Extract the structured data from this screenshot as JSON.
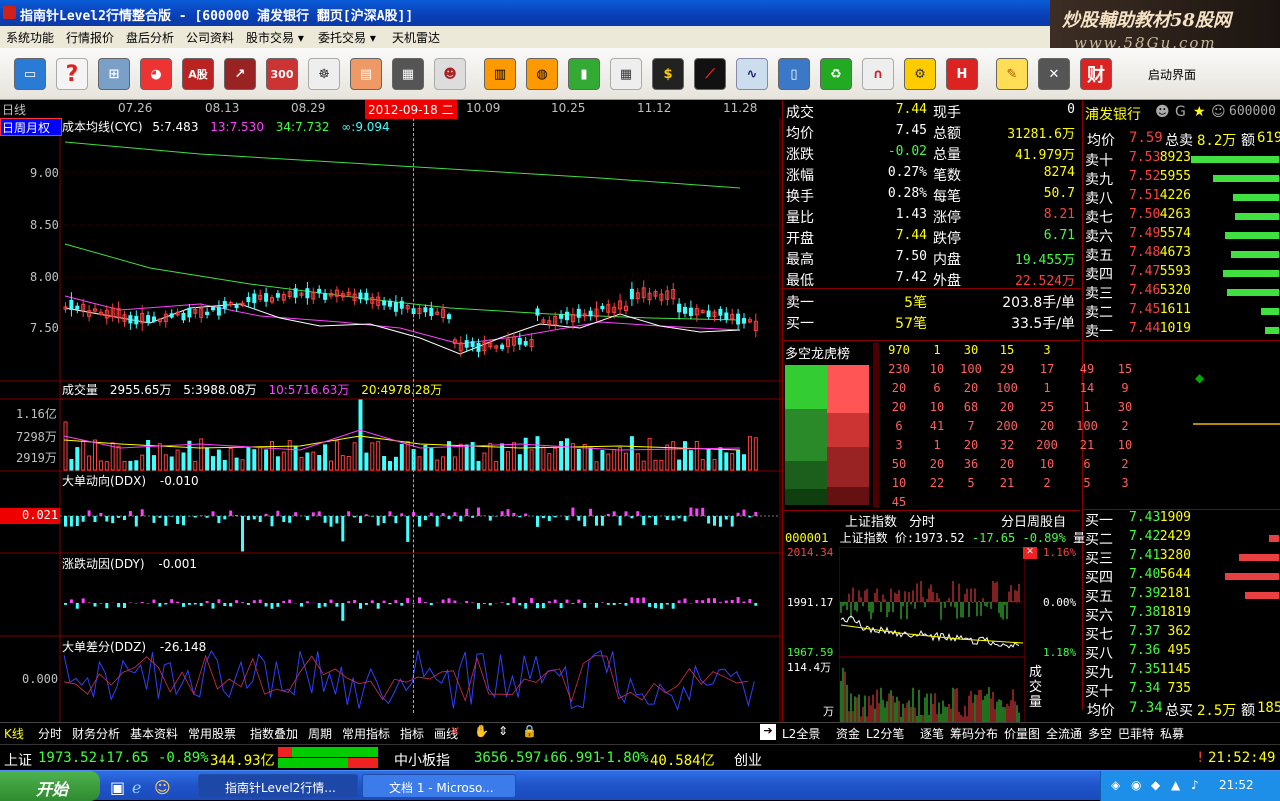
{
  "window": {
    "title": "指南针Level2行情整合版 - [600000 浦发银行 翻页[沪深A股]]"
  },
  "watermark": {
    "line1": "炒股輔助教材58股网",
    "line2": "www.58Gu.com"
  },
  "menu": [
    "系统功能",
    "行情报价",
    "盘后分析",
    "公司资料",
    "股市交易 ▾",
    "委托交易 ▾",
    "天机雷达"
  ],
  "toolbar": {
    "start_label": "启动界面",
    "icons": [
      "monitor-icon",
      "help-icon",
      "network-icon",
      "pie-icon",
      "a-share-icon",
      "chart-icon",
      "index300-icon",
      "helm-icon",
      "books-icon",
      "report-icon",
      "robot-icon",
      "calendar-icon",
      "ball-icon",
      "bar-icon",
      "grid-icon",
      "dollar-icon",
      "trend-icon",
      "line-icon",
      "cylinder-icon",
      "recycle-icon",
      "magnet-icon",
      "gear-icon",
      "h-icon",
      "pencil-icon",
      "swords-icon",
      "finance-icon"
    ]
  },
  "kline": {
    "period": "日线",
    "tabs": "日周月权",
    "indicator": "成本均线(CYC)",
    "ma5": "5:7.483",
    "ma13": "13:7.530",
    "ma34": "34:7.732",
    "mainf": "∞:9.094",
    "dates": [
      "07.26",
      "08.13",
      "08.29",
      "10.09",
      "10.25",
      "11.12",
      "11.28"
    ],
    "cursor_date": "2012-09-18 二",
    "yticks": [
      "9.00",
      "8.50",
      "8.00",
      "7.50"
    ]
  },
  "volume": {
    "label": "成交量",
    "value": "2955.65万",
    "ma5": "5:3988.08万",
    "ma10": "10:5716.63万",
    "ma20": "20:4978.28万",
    "ticks": [
      "1.16亿",
      "7298万",
      "2919万"
    ]
  },
  "ddx": {
    "label": "大单动向(DDX)",
    "value": "-0.010",
    "highlight": "0.021"
  },
  "ddy": {
    "label": "涨跌动因(DDY)",
    "value": "-0.001"
  },
  "ddz": {
    "label": "大单差分(DDZ)",
    "value": "-26.148",
    "tick": "0.000"
  },
  "quote": {
    "rows": [
      [
        "成交",
        "7.44",
        "现手",
        "0"
      ],
      [
        "均价",
        "7.45",
        "总额",
        "31281.6万"
      ],
      [
        "涨跌",
        "-0.02",
        "总量",
        "41.979万"
      ],
      [
        "涨幅",
        "0.27%",
        "笔数",
        "8274"
      ],
      [
        "换手",
        "0.28%",
        "每笔",
        "50.7"
      ],
      [
        "量比",
        "1.43",
        "涨停",
        "8.21"
      ],
      [
        "开盘",
        "7.44",
        "跌停",
        "6.71"
      ],
      [
        "最高",
        "7.50",
        "内盘",
        "19.455万"
      ],
      [
        "最低",
        "7.42",
        "外盘",
        "22.524万"
      ]
    ],
    "sell1": [
      "卖一",
      "5笔",
      "203.8手/单"
    ],
    "buy1": [
      "买一",
      "57笔",
      "33.5手/单"
    ]
  },
  "orderbook": {
    "name": "浦发银行",
    "code": "600000",
    "avg_label": "均价",
    "avg_value": "7.59",
    "total_sell_label": "总卖",
    "total_sell": "8.2万",
    "amount_label": "额",
    "amount": "619",
    "sells": [
      [
        "卖十",
        "7.53",
        "8923"
      ],
      [
        "卖九",
        "7.52",
        "5955"
      ],
      [
        "卖八",
        "7.51",
        "4226"
      ],
      [
        "卖七",
        "7.50",
        "4263"
      ],
      [
        "卖六",
        "7.49",
        "5574"
      ],
      [
        "卖五",
        "7.48",
        "4673"
      ],
      [
        "卖四",
        "7.47",
        "5593"
      ],
      [
        "卖三",
        "7.46",
        "5320"
      ],
      [
        "卖二",
        "7.45",
        "1611"
      ],
      [
        "卖一",
        "7.44",
        "1019"
      ]
    ],
    "buys": [
      [
        "买一",
        "7.43",
        "1909"
      ],
      [
        "买二",
        "7.42",
        "2429"
      ],
      [
        "买三",
        "7.41",
        "3280"
      ],
      [
        "买四",
        "7.40",
        "5644"
      ],
      [
        "买五",
        "7.39",
        "2181"
      ],
      [
        "买六",
        "7.38",
        "1819"
      ],
      [
        "买七",
        "7.37",
        "362"
      ],
      [
        "买八",
        "7.36",
        "495"
      ],
      [
        "买九",
        "7.35",
        "1145"
      ],
      [
        "买十",
        "7.34",
        "735"
      ]
    ],
    "buy_avg_label": "均价",
    "buy_avg": "7.34",
    "total_buy_label": "总买",
    "total_buy": "2.5万",
    "buy_amount": "185"
  },
  "dragon": {
    "title": "多空龙虎榜",
    "rows": [
      [
        "970",
        "1",
        "30",
        "15",
        "3",
        "",
        ""
      ],
      [
        "230",
        "10",
        "100",
        "29",
        "17",
        "49",
        "15"
      ],
      [
        "20",
        "6",
        "20",
        "100",
        "1",
        "14",
        "9"
      ],
      [
        "20",
        "10",
        "68",
        "20",
        "25",
        "1",
        "30"
      ],
      [
        "6",
        "41",
        "7",
        "200",
        "20",
        "100",
        "2"
      ],
      [
        "3",
        "1",
        "20",
        "32",
        "200",
        "21",
        "10"
      ],
      [
        "50",
        "20",
        "36",
        "20",
        "10",
        "6",
        "2"
      ],
      [
        "10",
        "22",
        "5",
        "21",
        "2",
        "5",
        "3"
      ],
      [
        "45",
        "",
        "",
        "",
        "",
        "",
        ""
      ]
    ]
  },
  "index": {
    "tab1": "上证指数",
    "tab2": "分时",
    "tabs_right": "分日周股自",
    "code": "000001",
    "name": "上证指数",
    "price": "价:1973.52",
    "chg": "-17.65",
    "pct": "-0.89%",
    "vol_label": "量",
    "y_high": "2014.34",
    "y_mid": "1991.17",
    "y_low": "1967.59",
    "pct_high": "1.16%",
    "pct_mid": "0.00%",
    "pct_low": "1.18%",
    "vol_max": "114.4万",
    "vol_unit": "万",
    "vol_title": "成交量"
  },
  "bottom_tabs": [
    "K线",
    "分时",
    "财务分析",
    "基本资料",
    "常用股票",
    "指数叠加",
    "周期",
    "常用指标",
    "指标",
    "画线"
  ],
  "bottom_tabs_right": [
    "L2全景",
    "资金",
    "L2分笔",
    "逐笔",
    "筹码分布",
    "价量图",
    "全流通",
    "多空",
    "巴菲特",
    "私募"
  ],
  "status": {
    "sh_label": "上证",
    "sh_price": "1973.52",
    "sh_chg": "↓17.65",
    "sh_pct": "-0.89%",
    "sh_amt": "344.93亿",
    "zx_label": "中小板指",
    "zx_price": "3656.597",
    "zx_chg": "↓66.991",
    "zx_pct": "-1.80%",
    "zx_amt": "40.584亿",
    "cy_label": "创业",
    "time": "21:52:49"
  },
  "taskbar": {
    "start": "开始",
    "task1": "指南针Level2行情...",
    "task2": "文档 1 - Microso...",
    "clock": "21:52"
  }
}
